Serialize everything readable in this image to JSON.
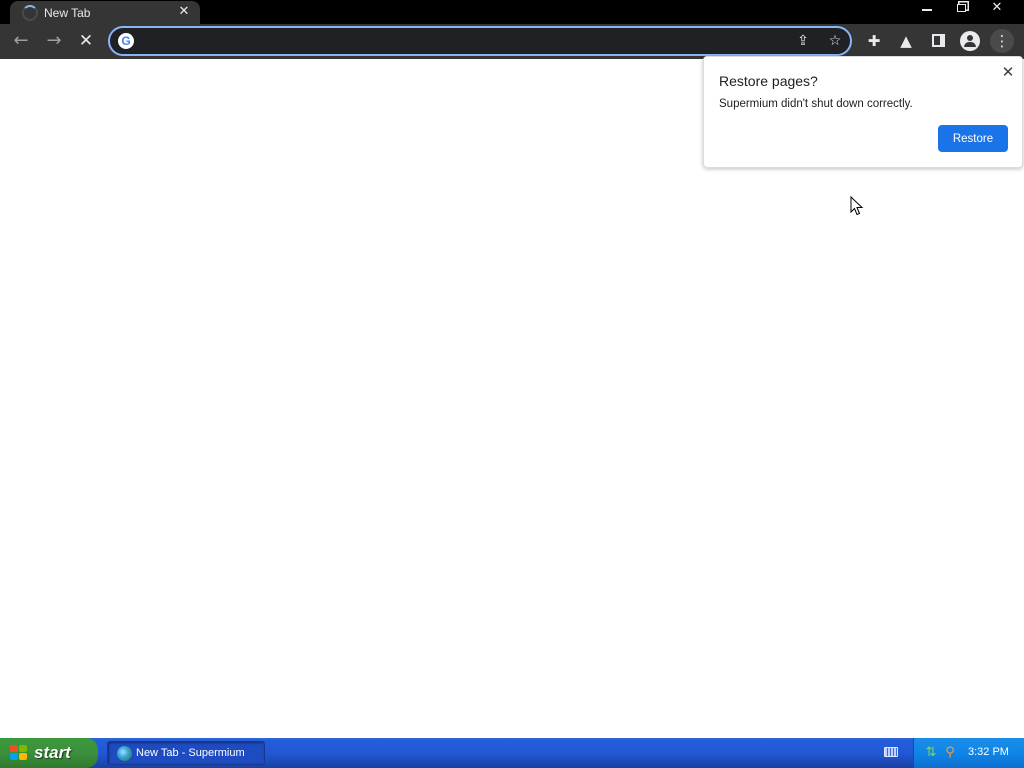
{
  "browser": {
    "tab": {
      "title": "New Tab"
    },
    "window_controls": {
      "minimize": "minimize",
      "restore": "restore",
      "close": "close"
    },
    "toolbar": {
      "omnibox": {
        "value": "",
        "placeholder": ""
      }
    }
  },
  "restore_bubble": {
    "title": "Restore pages?",
    "message": "Supermium didn't shut down correctly.",
    "button_label": "Restore"
  },
  "taskbar": {
    "start_label": "start",
    "tasks": [
      {
        "label": "New Tab - Supermium"
      }
    ],
    "clock": "3:32 PM"
  },
  "colors": {
    "accent": "#1a73e8",
    "omnibox_focus": "#8ab4f8",
    "toolbar_bg": "#353535",
    "taskbar_blue": "#245edb",
    "start_green": "#3c8f3c"
  }
}
